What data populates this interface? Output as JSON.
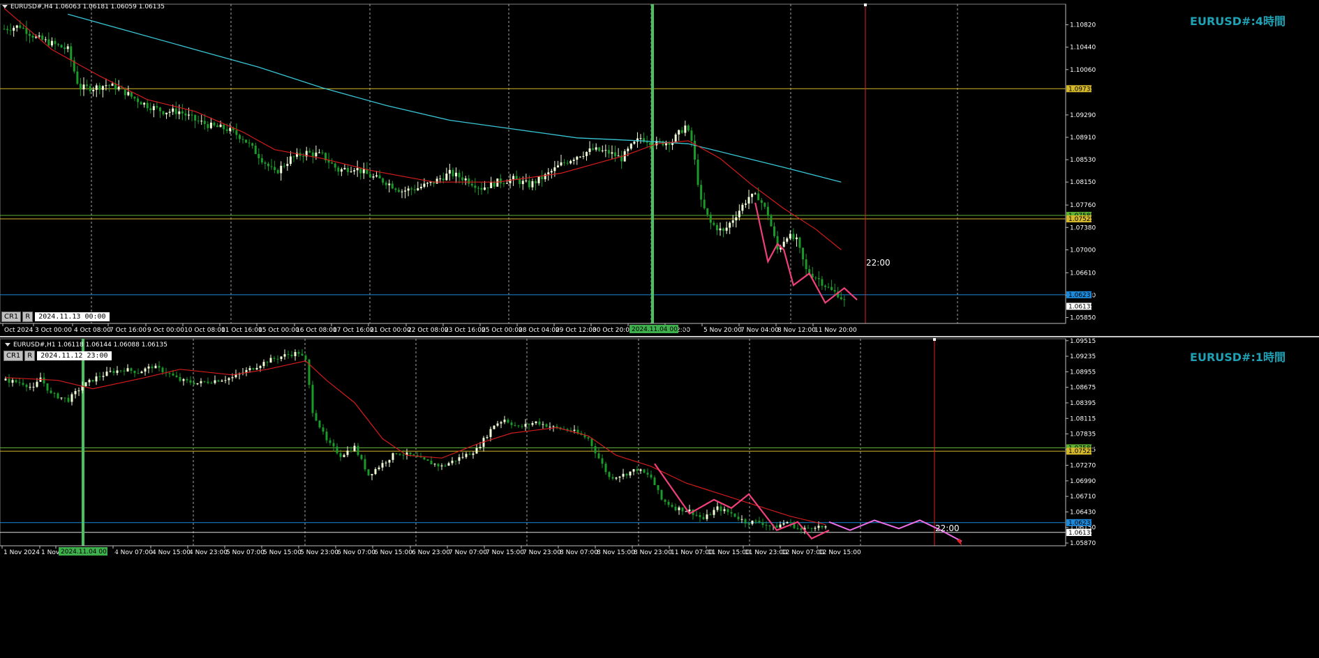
{
  "colors": {
    "background": "#000000",
    "grid": "#c0c0c0",
    "bull_candle": "#f0ffd8",
    "bear_candle": "#1a9a2a",
    "ma_fast": "#d41b1b",
    "ma_slow": "#38c7d6",
    "zigzag": "#f0407a",
    "forecast": "#ee6ee8",
    "level_yellow": "#d4b82c",
    "level_green": "#5db234",
    "level_blue": "#1e88d8",
    "level_white": "#e0e0e0",
    "vline_green": "#4ac060",
    "vline_red": "#e02020",
    "watermark": "#1fa2b5"
  },
  "panes": [
    {
      "id": "h4",
      "header": "EURUSD#,H4  1.06063 1.06181 1.06059 1.06135",
      "watermark": "EURUSD#:4時間",
      "crosshair": {
        "b1": "CR1",
        "b2": "R",
        "datetime": "2024.11.13 00:00"
      },
      "price_labels": [
        "1.10820",
        "1.10440",
        "1.10060",
        "1.09290",
        "1.08910",
        "1.08530",
        "1.08150",
        "1.07760",
        "1.07380",
        "1.07000",
        "1.06610",
        "1.06230",
        "1.05850"
      ],
      "ylim": [
        1.0575,
        1.1117
      ],
      "levels": [
        {
          "price": 1.09735,
          "label": "1.09735",
          "color_key": "level_yellow",
          "label_bg": "#d4b82c"
        },
        {
          "price": 1.07585,
          "label": "1.07585",
          "color_key": "level_green",
          "label_bg": "#5db234"
        },
        {
          "price": 1.07525,
          "label": "1.07525",
          "color_key": "level_yellow",
          "label_bg": "#d4b82c"
        },
        {
          "price": 1.06237,
          "label": "1.06237",
          "color_key": "level_blue",
          "label_bg": "#1e88d8"
        }
      ],
      "last_price": "1.06135",
      "time_labels": [
        "Oct 2024",
        "3 Oct 00:00",
        "4 Oct 08:00",
        "7 Oct 16:00",
        "9 Oct 00:00",
        "10 Oct 08:00",
        "11 Oct 16:00",
        "15 Oct 00:00",
        "16 Oct 08:00",
        "17 Oct 16:00",
        "21 Oct 00:00",
        "22 Oct 08:00",
        "23 Oct 16:00",
        "25 Oct 00:00",
        "28 Oct 04:00",
        "29 Oct 12:00",
        "30 Oct 20:00",
        "",
        "v 12:00",
        "5 Nov 20:00",
        "7 Nov 04:00",
        "8 Nov 12:00",
        "11 Nov 20:00"
      ],
      "highlight_time": "2024.11.04 00:00",
      "marker_time": "22:00"
    },
    {
      "id": "h1",
      "header": "EURUSD#,H1  1.06118 1.06144 1.06088 1.06135",
      "watermark": "EURUSD#:1時間",
      "crosshair": {
        "b1": "CR1",
        "b2": "R",
        "datetime": "2024.11.12 23:00"
      },
      "price_labels": [
        "1.09515",
        "1.09235",
        "1.08955",
        "1.08675",
        "1.08395",
        "1.08115",
        "1.07835",
        "1.07555",
        "1.07270",
        "1.06990",
        "1.06710",
        "1.06430",
        "1.06150",
        "1.05870"
      ],
      "ylim": [
        1.0582,
        1.0955
      ],
      "levels": [
        {
          "price": 1.07585,
          "label": "1.07585",
          "color_key": "level_green",
          "label_bg": "#5db234"
        },
        {
          "price": 1.07525,
          "label": "1.07525",
          "color_key": "level_yellow",
          "label_bg": "#d4b82c"
        },
        {
          "price": 1.06237,
          "label": "1.06237",
          "color_key": "level_blue",
          "label_bg": "#1e88d8"
        },
        {
          "price": 1.06062,
          "label": "1.06062",
          "color_key": "level_white",
          "label_bg": "#ffffff"
        }
      ],
      "last_price": "1.06135",
      "time_labels": [
        "1 Nov 2024",
        "1 Nov 1",
        "",
        "4 Nov 07:00",
        "4 Nov 15:00",
        "4 Nov 23:00",
        "5 Nov 07:00",
        "5 Nov 15:00",
        "5 Nov 23:00",
        "6 Nov 07:00",
        "6 Nov 15:00",
        "6 Nov 23:00",
        "7 Nov 07:00",
        "7 Nov 15:00",
        "7 Nov 23:00",
        "8 Nov 07:00",
        "8 Nov 15:00",
        "8 Nov 23:00",
        "11 Nov 07:00",
        "11 Nov 15:00",
        "11 Nov 23:00",
        "12 Nov 07:00",
        "12 Nov 15:00"
      ],
      "highlight_time": "2024.11.04 00:00",
      "marker_time": "22:00"
    }
  ],
  "chart_data": [
    {
      "type": "candlestick",
      "title": "EURUSD#,H4",
      "ylim": [
        1.0575,
        1.1117
      ],
      "close_path": [
        [
          0,
          1.1075
        ],
        [
          5,
          1.108
        ],
        [
          10,
          1.106
        ],
        [
          15,
          1.105
        ],
        [
          20,
          1.104
        ],
        [
          23,
          1.0985
        ],
        [
          24,
          1.0975
        ],
        [
          28,
          1.0975
        ],
        [
          32,
          1.098
        ],
        [
          36,
          1.0975
        ],
        [
          40,
          1.096
        ],
        [
          45,
          1.0945
        ],
        [
          50,
          1.0935
        ],
        [
          55,
          1.0935
        ],
        [
          60,
          1.092
        ],
        [
          65,
          1.091
        ],
        [
          70,
          1.0905
        ],
        [
          75,
          1.089
        ],
        [
          80,
          1.086
        ],
        [
          85,
          1.083
        ],
        [
          90,
          1.0855
        ],
        [
          95,
          1.0865
        ],
        [
          100,
          1.086
        ],
        [
          105,
          1.0835
        ],
        [
          110,
          1.084
        ],
        [
          115,
          1.0825
        ],
        [
          120,
          1.0815
        ],
        [
          125,
          1.08
        ],
        [
          130,
          1.0805
        ],
        [
          135,
          1.0815
        ],
        [
          140,
          1.083
        ],
        [
          145,
          1.082
        ],
        [
          150,
          1.0805
        ],
        [
          155,
          1.0815
        ],
        [
          160,
          1.082
        ],
        [
          165,
          1.081
        ],
        [
          170,
          1.0825
        ],
        [
          175,
          1.0845
        ],
        [
          180,
          1.086
        ],
        [
          185,
          1.087
        ],
        [
          190,
          1.0865
        ],
        [
          194,
          1.0855
        ],
        [
          197,
          1.0875
        ],
        [
          200,
          1.089
        ],
        [
          205,
          1.088
        ],
        [
          210,
          1.0885
        ],
        [
          214,
          1.091
        ],
        [
          216,
          1.0885
        ],
        [
          219,
          1.078
        ],
        [
          222,
          1.0745
        ],
        [
          226,
          1.073
        ],
        [
          230,
          1.076
        ],
        [
          234,
          1.079
        ],
        [
          237,
          1.079
        ],
        [
          240,
          1.076
        ],
        [
          243,
          1.07
        ],
        [
          246,
          1.0725
        ],
        [
          249,
          1.0715
        ],
        [
          252,
          1.0665
        ],
        [
          256,
          1.065
        ],
        [
          260,
          1.063
        ],
        [
          262,
          1.0625
        ],
        [
          264,
          1.0613
        ]
      ],
      "ma_fast_path": [
        [
          0,
          1.111
        ],
        [
          15,
          1.104
        ],
        [
          30,
          1.0995
        ],
        [
          45,
          1.0955
        ],
        [
          60,
          1.0935
        ],
        [
          75,
          1.09
        ],
        [
          85,
          1.087
        ],
        [
          100,
          1.0855
        ],
        [
          115,
          1.0835
        ],
        [
          135,
          1.0815
        ],
        [
          155,
          1.0815
        ],
        [
          175,
          1.083
        ],
        [
          195,
          1.086
        ],
        [
          205,
          1.088
        ],
        [
          215,
          1.0885
        ],
        [
          225,
          1.0855
        ],
        [
          235,
          1.081
        ],
        [
          245,
          1.077
        ],
        [
          255,
          1.0735
        ],
        [
          263,
          1.07
        ]
      ],
      "ma_slow_path": [
        [
          20,
          1.11
        ],
        [
          40,
          1.107
        ],
        [
          60,
          1.104
        ],
        [
          80,
          1.101
        ],
        [
          100,
          1.0975
        ],
        [
          120,
          1.0945
        ],
        [
          140,
          1.092
        ],
        [
          160,
          1.0905
        ],
        [
          180,
          1.089
        ],
        [
          200,
          1.0885
        ],
        [
          215,
          1.088
        ],
        [
          230,
          1.086
        ],
        [
          245,
          1.084
        ],
        [
          263,
          1.0815
        ]
      ],
      "zigzag": [
        [
          236,
          1.078
        ],
        [
          240,
          1.068
        ],
        [
          243,
          1.071
        ],
        [
          245,
          1.07
        ],
        [
          248,
          1.064
        ],
        [
          253,
          1.066
        ],
        [
          258,
          1.061
        ],
        [
          264,
          1.0635
        ],
        [
          268,
          1.0615
        ]
      ]
    },
    {
      "type": "candlestick",
      "title": "EURUSD#,H1",
      "ylim": [
        1.0582,
        1.0955
      ],
      "close_path": [
        [
          0,
          1.088
        ],
        [
          5,
          1.0875
        ],
        [
          8,
          1.0865
        ],
        [
          10,
          1.0885
        ],
        [
          13,
          1.0855
        ],
        [
          18,
          1.0845
        ],
        [
          22,
          1.087
        ],
        [
          26,
          1.0885
        ],
        [
          30,
          1.0895
        ],
        [
          34,
          1.09
        ],
        [
          38,
          1.0895
        ],
        [
          42,
          1.0905
        ],
        [
          46,
          1.0895
        ],
        [
          50,
          1.088
        ],
        [
          55,
          1.0875
        ],
        [
          60,
          1.088
        ],
        [
          65,
          1.0885
        ],
        [
          70,
          1.09
        ],
        [
          75,
          1.0915
        ],
        [
          80,
          1.0925
        ],
        [
          84,
          1.093
        ],
        [
          86,
          1.0915
        ],
        [
          88,
          1.0825
        ],
        [
          92,
          1.077
        ],
        [
          96,
          1.0745
        ],
        [
          100,
          1.076
        ],
        [
          104,
          1.071
        ],
        [
          108,
          1.073
        ],
        [
          112,
          1.075
        ],
        [
          116,
          1.0745
        ],
        [
          120,
          1.0735
        ],
        [
          125,
          1.0725
        ],
        [
          130,
          1.074
        ],
        [
          135,
          1.0755
        ],
        [
          140,
          1.08
        ],
        [
          143,
          1.081
        ],
        [
          147,
          1.0795
        ],
        [
          152,
          1.0805
        ],
        [
          157,
          1.0795
        ],
        [
          162,
          1.079
        ],
        [
          167,
          1.0775
        ],
        [
          170,
          1.074
        ],
        [
          173,
          1.0705
        ],
        [
          177,
          1.071
        ],
        [
          181,
          1.072
        ],
        [
          185,
          1.0705
        ],
        [
          188,
          1.0665
        ],
        [
          192,
          1.065
        ],
        [
          196,
          1.0645
        ],
        [
          200,
          1.063
        ],
        [
          204,
          1.065
        ],
        [
          208,
          1.064
        ],
        [
          212,
          1.0625
        ],
        [
          216,
          1.0625
        ],
        [
          220,
          1.0615
        ],
        [
          224,
          1.0625
        ],
        [
          228,
          1.061
        ],
        [
          232,
          1.0618
        ],
        [
          235,
          1.0613
        ]
      ],
      "ma_fast_path": [
        [
          0,
          1.0885
        ],
        [
          15,
          1.088
        ],
        [
          25,
          1.0865
        ],
        [
          40,
          1.0885
        ],
        [
          50,
          1.09
        ],
        [
          65,
          1.089
        ],
        [
          75,
          1.09
        ],
        [
          86,
          1.0915
        ],
        [
          92,
          1.088
        ],
        [
          100,
          1.084
        ],
        [
          108,
          1.0775
        ],
        [
          115,
          1.0745
        ],
        [
          125,
          1.074
        ],
        [
          135,
          1.0765
        ],
        [
          145,
          1.0785
        ],
        [
          158,
          1.0795
        ],
        [
          167,
          1.078
        ],
        [
          175,
          1.0745
        ],
        [
          185,
          1.0725
        ],
        [
          195,
          1.0695
        ],
        [
          205,
          1.0675
        ],
        [
          215,
          1.0655
        ],
        [
          225,
          1.0635
        ],
        [
          235,
          1.062
        ]
      ],
      "ma_slow_path": [],
      "zigzag": [
        [
          186,
          1.073
        ],
        [
          196,
          1.064
        ],
        [
          203,
          1.0665
        ],
        [
          208,
          1.065
        ],
        [
          213,
          1.0675
        ],
        [
          221,
          1.061
        ],
        [
          227,
          1.0625
        ],
        [
          231,
          1.0595
        ],
        [
          236,
          1.061
        ]
      ],
      "forecast": [
        [
          236,
          1.0625
        ],
        [
          242,
          1.061
        ],
        [
          249,
          1.0628
        ],
        [
          256,
          1.0613
        ],
        [
          262,
          1.0628
        ],
        [
          268,
          1.061
        ],
        [
          274,
          1.059
        ]
      ]
    }
  ]
}
